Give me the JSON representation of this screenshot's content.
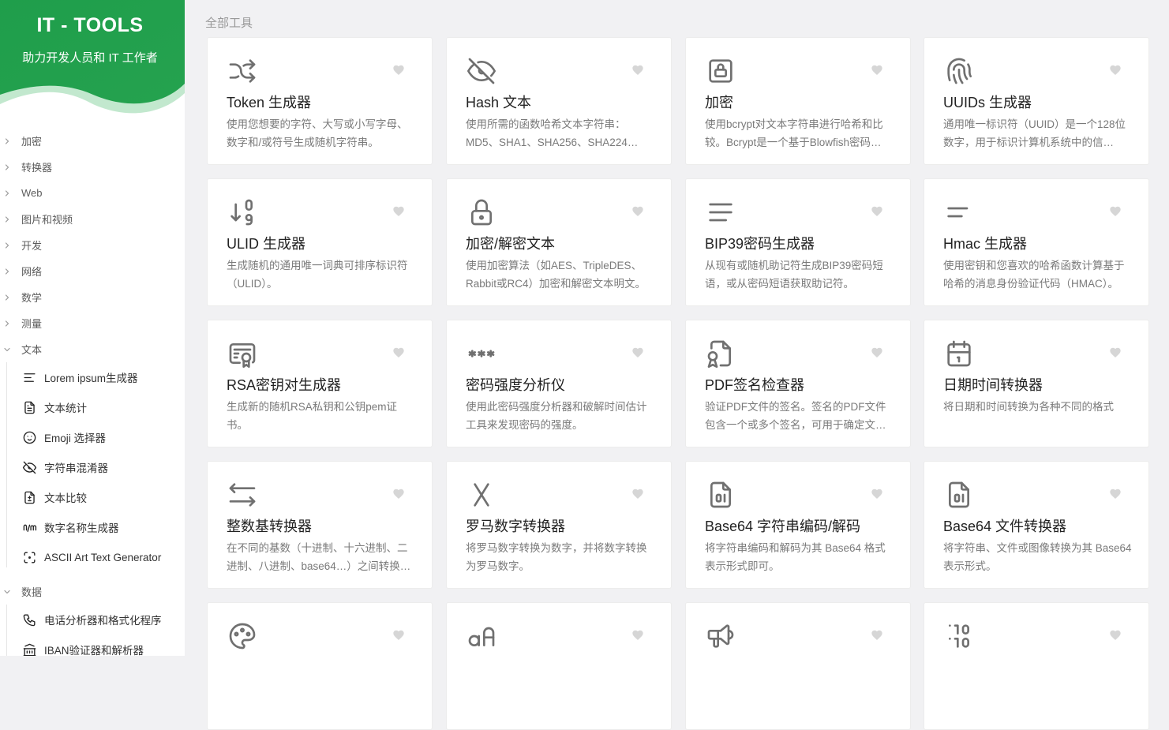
{
  "brand": {
    "title": "IT - TOOLS",
    "subtitle": "助力开发人员和 IT 工作者"
  },
  "section_title": "全部工具",
  "colors": {
    "brand_green": "#1ea54c",
    "brand_green_light": "#3ab96a",
    "icon_gray": "#707070",
    "heart_gray": "#d6d6d6"
  },
  "sidebar": {
    "groups": [
      {
        "label": "加密",
        "expanded": false
      },
      {
        "label": "转换器",
        "expanded": false
      },
      {
        "label": "Web",
        "expanded": false
      },
      {
        "label": "图片和视频",
        "expanded": false
      },
      {
        "label": "开发",
        "expanded": false
      },
      {
        "label": "网络",
        "expanded": false
      },
      {
        "label": "数学",
        "expanded": false
      },
      {
        "label": "测量",
        "expanded": false
      },
      {
        "label": "文本",
        "expanded": true
      },
      {
        "label": "数据",
        "expanded": true
      }
    ],
    "text_items": [
      {
        "label": "Lorem ipsum生成器",
        "icon": "align-left-icon"
      },
      {
        "label": "文本统计",
        "icon": "file-text-icon"
      },
      {
        "label": "Emoji 选择器",
        "icon": "mood-smile-icon"
      },
      {
        "label": "字符串混淆器",
        "icon": "eye-off-icon"
      },
      {
        "label": "文本比较",
        "icon": "file-diff-icon"
      },
      {
        "label": "数字名称生成器",
        "icon": "n-slash-m-icon"
      },
      {
        "label": "ASCII Art Text Generator",
        "icon": "focus-icon"
      }
    ],
    "data_items": [
      {
        "label": "电话分析器和格式化程序",
        "icon": "phone-icon"
      },
      {
        "label": "IBAN验证器和解析器",
        "icon": "bank-icon"
      }
    ]
  },
  "cards": [
    {
      "title": "Token 生成器",
      "desc": "使用您想要的字符、大写或小写字母、数字和/或符号生成随机字符串。",
      "icon": "shuffle-icon"
    },
    {
      "title": "Hash 文本",
      "desc": "使用所需的函数哈希文本字符串：MD5、SHA1、SHA256、SHA224…",
      "icon": "eye-off-icon"
    },
    {
      "title": "加密",
      "desc": "使用bcrypt对文本字符串进行哈希和比较。Bcrypt是一个基于Blowfish密码…",
      "icon": "lock-square-icon"
    },
    {
      "title": "UUIDs 生成器",
      "desc": "通用唯一标识符（UUID）是一个128位数字，用于标识计算机系统中的信…",
      "icon": "fingerprint-icon"
    },
    {
      "title": "ULID 生成器",
      "desc": "生成随机的通用唯一词典可排序标识符（ULID）。",
      "icon": "sort-numeric-icon"
    },
    {
      "title": "加密/解密文本",
      "desc": "使用加密算法（如AES、TripleDES、Rabbit或RC4）加密和解密文本明文。",
      "icon": "lock-icon"
    },
    {
      "title": "BIP39密码生成器",
      "desc": "从现有或随机助记符生成BIP39密码短语，或从密码短语获取助记符。",
      "icon": "align-justified-icon"
    },
    {
      "title": "Hmac 生成器",
      "desc": "使用密钥和您喜欢的哈希函数计算基于哈希的消息身份验证代码（HMAC）。",
      "icon": "short-text-icon"
    },
    {
      "title": "RSA密钥对生成器",
      "desc": "生成新的随机RSA私钥和公钥pem证书。",
      "icon": "certificate-icon"
    },
    {
      "title": "密码强度分析仪",
      "desc": "使用此密码强度分析器和破解时间估计工具来发现密码的强度。",
      "icon": "password-icon"
    },
    {
      "title": "PDF签名检查器",
      "desc": "验证PDF文件的签名。签名的PDF文件包含一个或多个签名，可用于确定文…",
      "icon": "file-certificate-icon"
    },
    {
      "title": "日期时间转换器",
      "desc": "将日期和时间转换为各种不同的格式",
      "icon": "calendar-icon"
    },
    {
      "title": "整数基转换器",
      "desc": "在不同的基数（十进制、十六进制、二进制、八进制、base64…）之间转换…",
      "icon": "arrows-left-right-icon"
    },
    {
      "title": "罗马数字转换器",
      "desc": "将罗马数字转换为数字，并将数字转换为罗马数字。",
      "icon": "letter-x-icon"
    },
    {
      "title": "Base64 字符串编码/解码",
      "desc": "将字符串编码和解码为其 Base64 格式表示形式即可。",
      "icon": "file-digit-icon"
    },
    {
      "title": "Base64 文件转换器",
      "desc": "将字符串、文件或图像转换为其 Base64 表示形式。",
      "icon": "file-digit-icon"
    },
    {
      "title": "",
      "desc": "",
      "icon": "palette-icon"
    },
    {
      "title": "",
      "desc": "",
      "icon": "letter-case-icon"
    },
    {
      "title": "",
      "desc": "",
      "icon": "speakerphone-icon"
    },
    {
      "title": "",
      "desc": "",
      "icon": "binary-icon"
    }
  ]
}
